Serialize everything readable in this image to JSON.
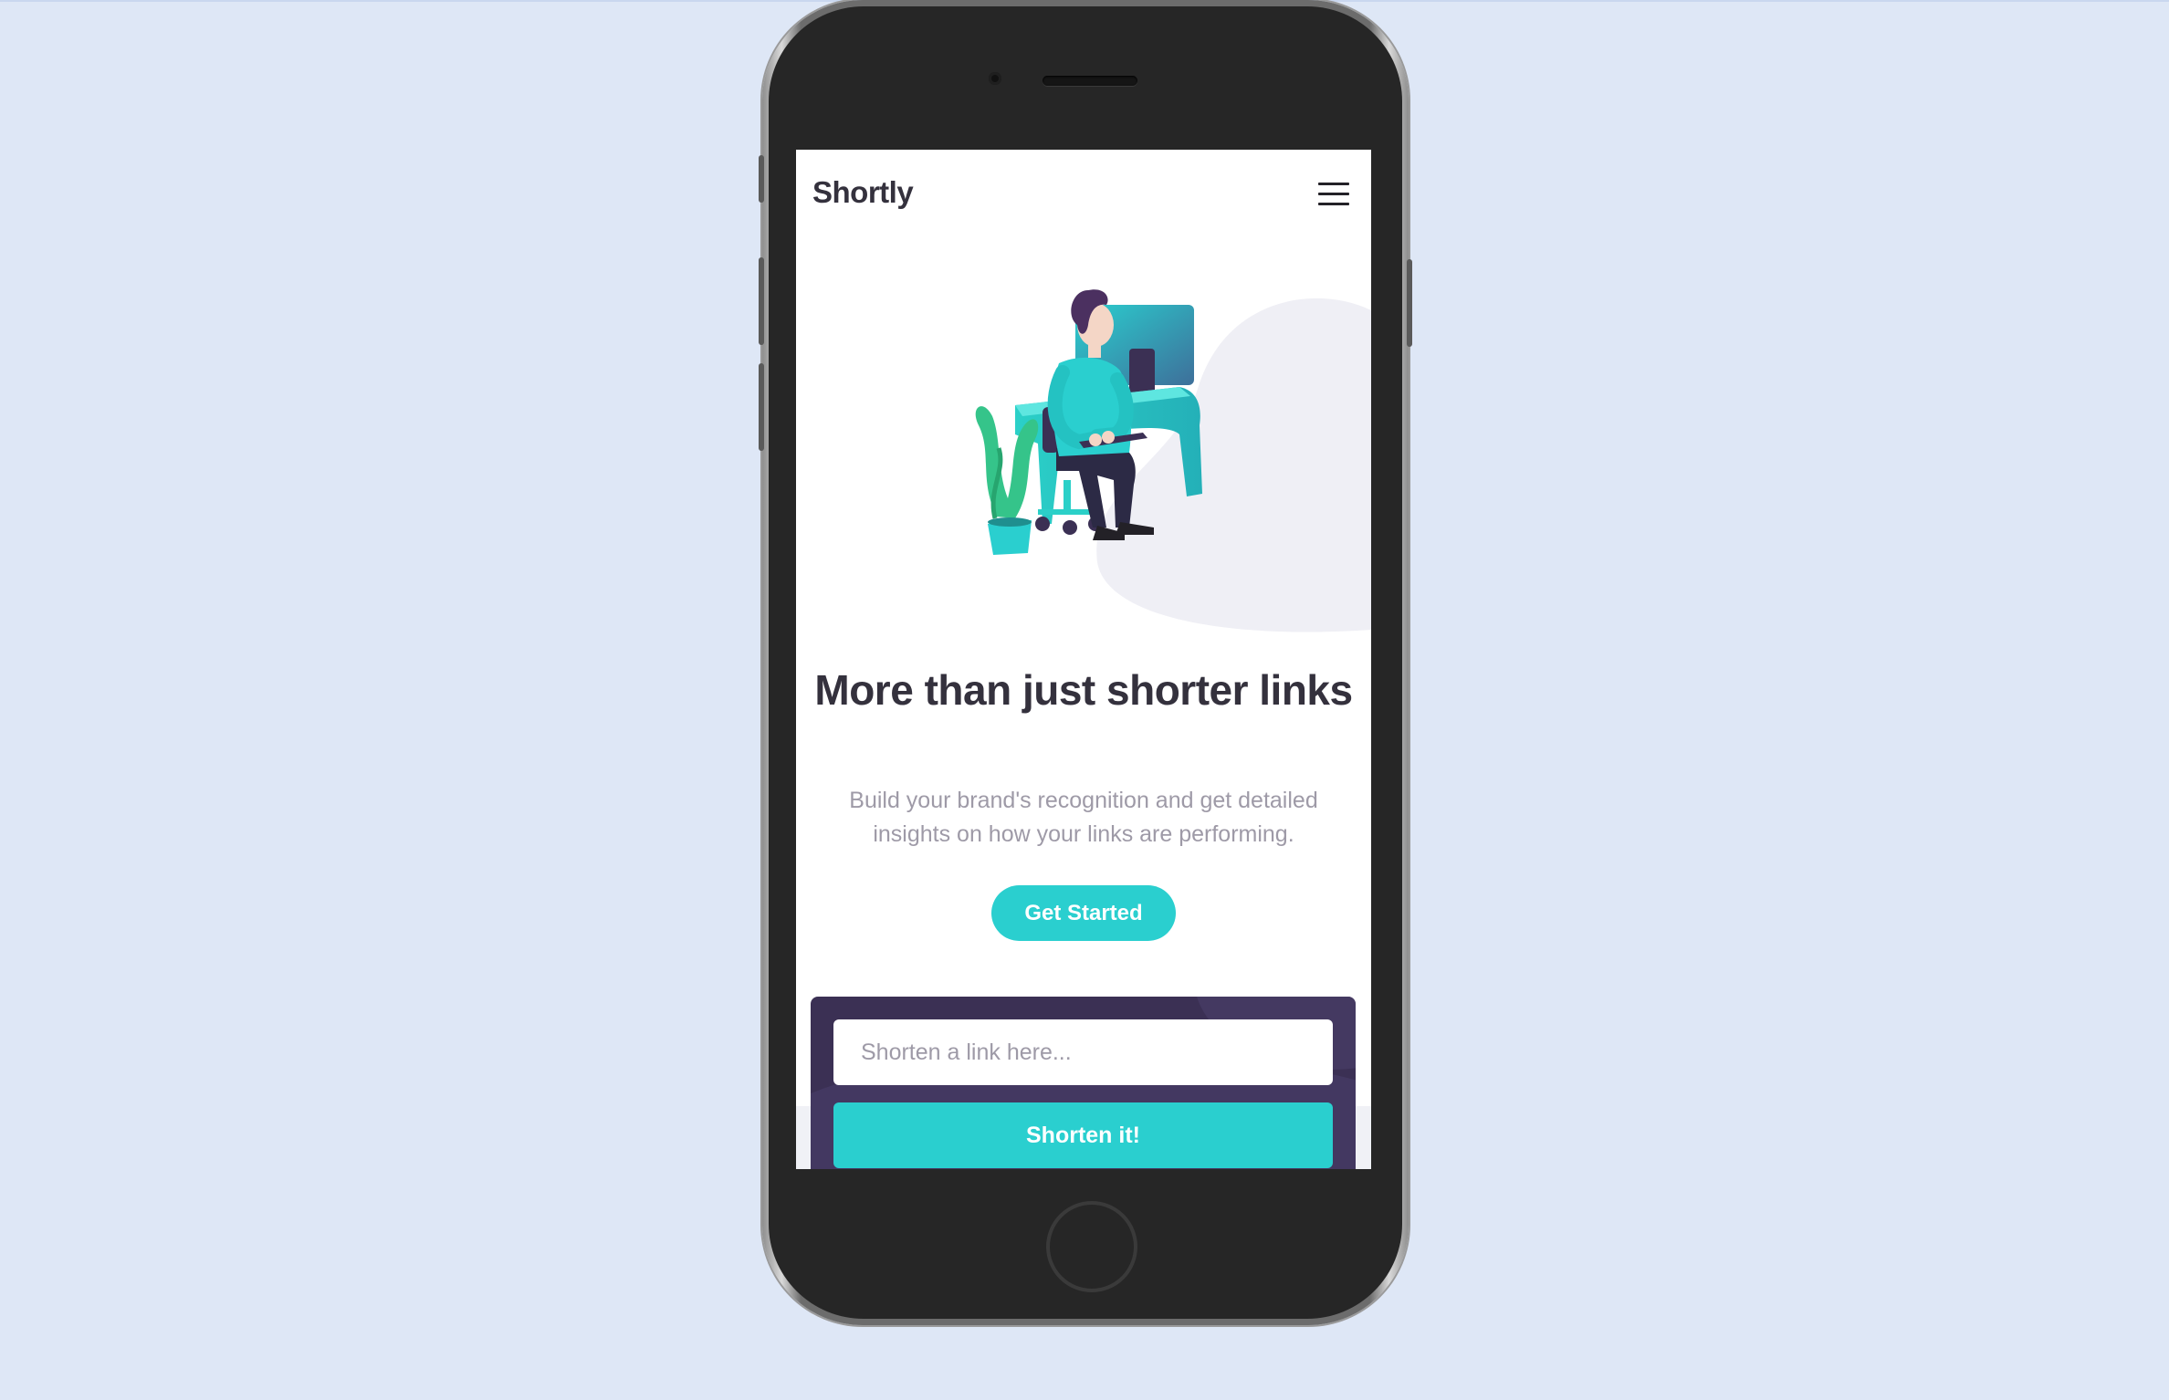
{
  "device": {
    "name": "phone-mockup"
  },
  "header": {
    "logo": "Shortly",
    "menu_icon": "hamburger-icon"
  },
  "hero": {
    "illustration_icon": "person-working-illustration",
    "title": "More than just shorter links",
    "description": "Build your brand's recognition and get detailed insights on how your links are performing.",
    "cta_label": "Get Started"
  },
  "shorten": {
    "placeholder": "Shorten a link here...",
    "value": "",
    "button_label": "Shorten it!"
  },
  "colors": {
    "primary": "#2acfcf",
    "dark_violet": "#3b3054",
    "very_dark_violet": "#232127",
    "grayish_violet": "#9e9aa7",
    "background": "#dee7f6"
  }
}
